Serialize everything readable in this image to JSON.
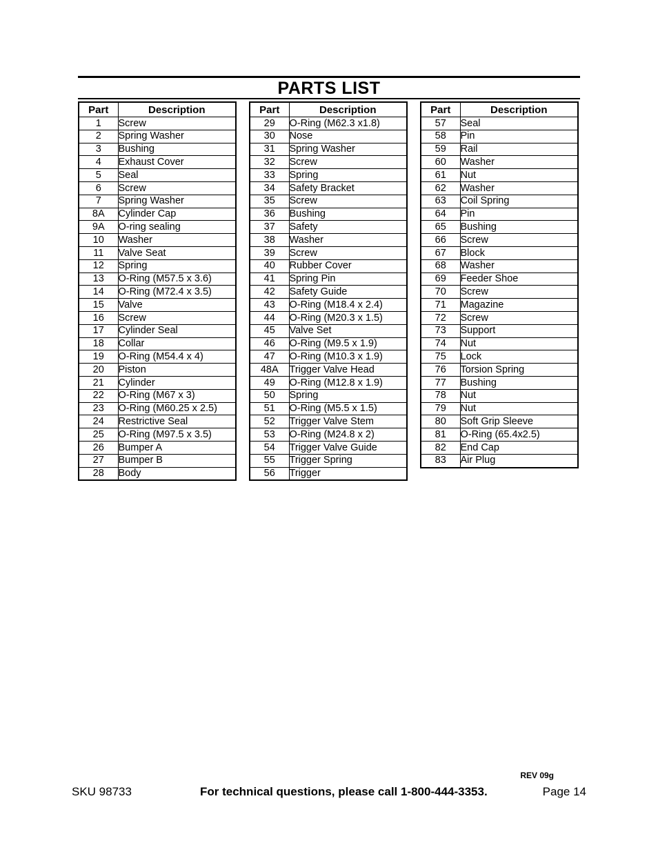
{
  "page_title": "PARTS LIST",
  "columns": [
    {
      "headers": {
        "part": "Part",
        "description": "Description"
      },
      "rows": [
        {
          "part": "1",
          "description": "Screw"
        },
        {
          "part": "2",
          "description": "Spring Washer"
        },
        {
          "part": "3",
          "description": "Bushing"
        },
        {
          "part": "4",
          "description": "Exhaust Cover"
        },
        {
          "part": "5",
          "description": "Seal"
        },
        {
          "part": "6",
          "description": "Screw"
        },
        {
          "part": "7",
          "description": "Spring Washer"
        },
        {
          "part": "8A",
          "description": "Cylinder Cap"
        },
        {
          "part": "9A",
          "description": "O-ring sealing"
        },
        {
          "part": "10",
          "description": "Washer"
        },
        {
          "part": "11",
          "description": "Valve Seat"
        },
        {
          "part": "12",
          "description": "Spring"
        },
        {
          "part": "13",
          "description": "O-Ring (M57.5 x 3.6)"
        },
        {
          "part": "14",
          "description": "O-Ring (M72.4 x 3.5)"
        },
        {
          "part": "15",
          "description": "Valve"
        },
        {
          "part": "16",
          "description": "Screw"
        },
        {
          "part": "17",
          "description": "Cylinder Seal"
        },
        {
          "part": "18",
          "description": "Collar"
        },
        {
          "part": "19",
          "description": "O-Ring (M54.4 x 4)"
        },
        {
          "part": "20",
          "description": "Piston"
        },
        {
          "part": "21",
          "description": "Cylinder"
        },
        {
          "part": "22",
          "description": "O-Ring (M67 x 3)"
        },
        {
          "part": "23",
          "description": "O-Ring (M60.25 x 2.5)"
        },
        {
          "part": "24",
          "description": "Restrictive Seal"
        },
        {
          "part": "25",
          "description": "O-Ring (M97.5 x 3.5)"
        },
        {
          "part": "26",
          "description": "Bumper A"
        },
        {
          "part": "27",
          "description": "Bumper B"
        },
        {
          "part": "28",
          "description": "Body"
        }
      ]
    },
    {
      "headers": {
        "part": "Part",
        "description": "Description"
      },
      "rows": [
        {
          "part": "29",
          "description": "O-Ring (M62.3 x1.8)"
        },
        {
          "part": "30",
          "description": "Nose"
        },
        {
          "part": "31",
          "description": "Spring Washer"
        },
        {
          "part": "32",
          "description": "Screw"
        },
        {
          "part": "33",
          "description": "Spring"
        },
        {
          "part": "34",
          "description": "Safety Bracket"
        },
        {
          "part": "35",
          "description": "Screw"
        },
        {
          "part": "36",
          "description": "Bushing"
        },
        {
          "part": "37",
          "description": "Safety"
        },
        {
          "part": "38",
          "description": "Washer"
        },
        {
          "part": "39",
          "description": "Screw"
        },
        {
          "part": "40",
          "description": "Rubber Cover"
        },
        {
          "part": "41",
          "description": "Spring Pin"
        },
        {
          "part": "42",
          "description": "Safety Guide"
        },
        {
          "part": "43",
          "description": "O-Ring (M18.4 x 2.4)"
        },
        {
          "part": "44",
          "description": "O-Ring (M20.3 x 1.5)"
        },
        {
          "part": "45",
          "description": "Valve Set"
        },
        {
          "part": "46",
          "description": "O-Ring (M9.5 x 1.9)"
        },
        {
          "part": "47",
          "description": "O-Ring (M10.3 x 1.9)"
        },
        {
          "part": "48A",
          "description": "Trigger Valve Head"
        },
        {
          "part": "49",
          "description": "O-Ring (M12.8 x 1.9)"
        },
        {
          "part": "50",
          "description": "Spring"
        },
        {
          "part": "51",
          "description": "O-Ring (M5.5 x 1.5)"
        },
        {
          "part": "52",
          "description": "Trigger Valve Stem"
        },
        {
          "part": "53",
          "description": "O-Ring (M24.8 x 2)"
        },
        {
          "part": "54",
          "description": "Trigger Valve Guide"
        },
        {
          "part": "55",
          "description": "Trigger Spring"
        },
        {
          "part": "56",
          "description": "Trigger"
        }
      ]
    },
    {
      "headers": {
        "part": "Part",
        "description": "Description"
      },
      "rows": [
        {
          "part": "57",
          "description": "Seal"
        },
        {
          "part": "58",
          "description": "Pin"
        },
        {
          "part": "59",
          "description": "Rail"
        },
        {
          "part": "60",
          "description": "Washer"
        },
        {
          "part": "61",
          "description": "Nut"
        },
        {
          "part": "62",
          "description": "Washer"
        },
        {
          "part": "63",
          "description": "Coil Spring"
        },
        {
          "part": "64",
          "description": "Pin"
        },
        {
          "part": "65",
          "description": "Bushing"
        },
        {
          "part": "66",
          "description": "Screw"
        },
        {
          "part": "67",
          "description": "Block"
        },
        {
          "part": "68",
          "description": "Washer"
        },
        {
          "part": "69",
          "description": "Feeder Shoe"
        },
        {
          "part": "70",
          "description": "Screw"
        },
        {
          "part": "71",
          "description": "Magazine"
        },
        {
          "part": "72",
          "description": "Screw"
        },
        {
          "part": "73",
          "description": "Support"
        },
        {
          "part": "74",
          "description": "Nut"
        },
        {
          "part": "75",
          "description": "Lock"
        },
        {
          "part": "76",
          "description": "Torsion Spring"
        },
        {
          "part": "77",
          "description": "Bushing"
        },
        {
          "part": "78",
          "description": "Nut"
        },
        {
          "part": "79",
          "description": "Nut"
        },
        {
          "part": "80",
          "description": "Soft Grip Sleeve"
        },
        {
          "part": "81",
          "description": "O-Ring (65.4x2.5)"
        },
        {
          "part": "82",
          "description": "End Cap"
        },
        {
          "part": "83",
          "description": "Air Plug"
        }
      ]
    }
  ],
  "footer": {
    "revision": "REV 09g",
    "sku": "SKU 98733",
    "tech_questions": "For technical questions, please call 1-800-444-3353.",
    "page": "Page 14"
  }
}
